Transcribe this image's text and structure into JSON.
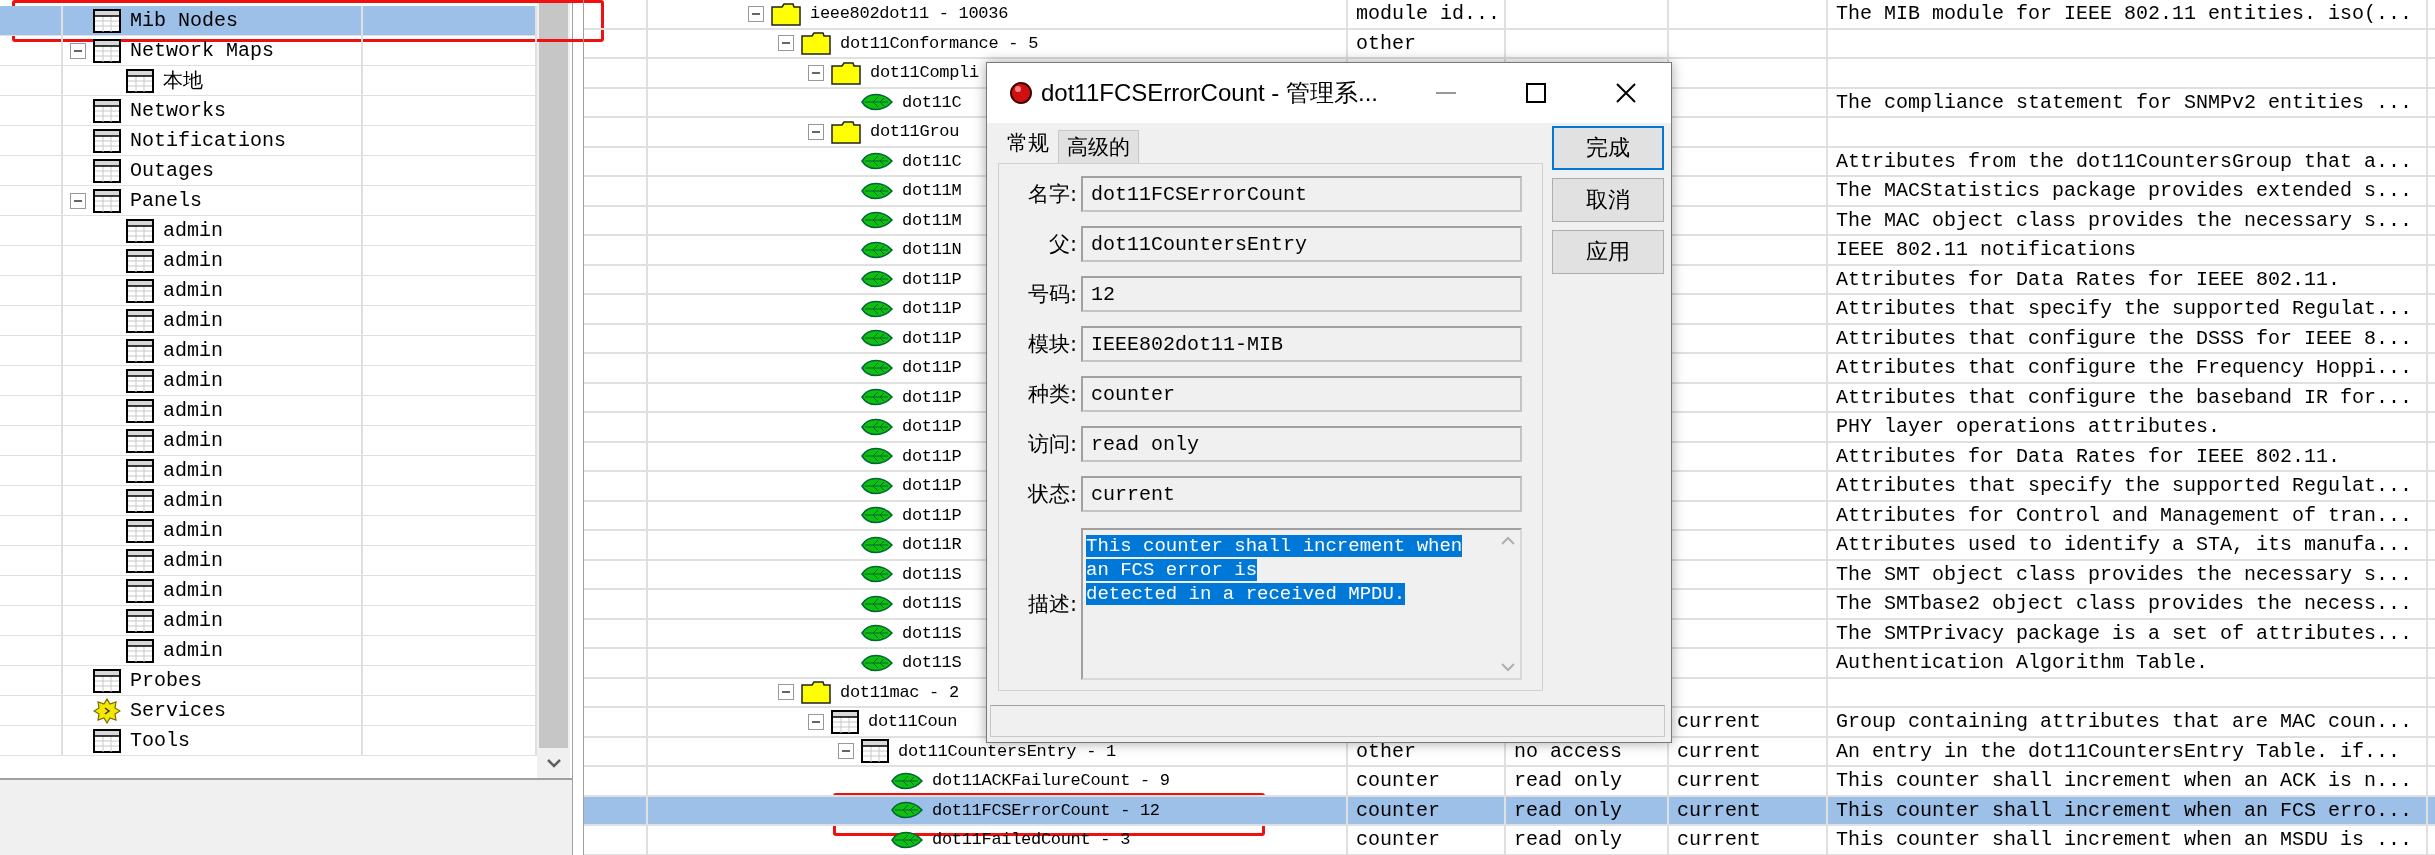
{
  "left_tree": [
    {
      "label": "Mib Nodes",
      "kind": "table",
      "selected": true,
      "highlighted": true
    },
    {
      "label": "Network Maps",
      "kind": "table",
      "selected": false,
      "expanded": true,
      "children": [
        {
          "label": "本地",
          "kind": "table",
          "selected": false
        }
      ]
    },
    {
      "label": "Networks",
      "kind": "table",
      "selected": false
    },
    {
      "label": "Notifications",
      "kind": "table",
      "selected": false
    },
    {
      "label": "Outages",
      "kind": "table",
      "selected": false
    },
    {
      "label": "Panels",
      "kind": "table",
      "selected": false,
      "expanded": true,
      "children": [
        {
          "label": "admin",
          "kind": "table",
          "selected": false
        },
        {
          "label": "admin",
          "kind": "table",
          "selected": false
        },
        {
          "label": "admin",
          "kind": "table",
          "selected": false
        },
        {
          "label": "admin",
          "kind": "table",
          "selected": false
        },
        {
          "label": "admin",
          "kind": "table",
          "selected": false
        },
        {
          "label": "admin",
          "kind": "table",
          "selected": false
        },
        {
          "label": "admin",
          "kind": "table",
          "selected": false
        },
        {
          "label": "admin",
          "kind": "table",
          "selected": false
        },
        {
          "label": "admin",
          "kind": "table",
          "selected": false
        },
        {
          "label": "admin",
          "kind": "table",
          "selected": false
        },
        {
          "label": "admin",
          "kind": "table",
          "selected": false
        },
        {
          "label": "admin",
          "kind": "table",
          "selected": false
        },
        {
          "label": "admin",
          "kind": "table",
          "selected": false
        },
        {
          "label": "admin",
          "kind": "table",
          "selected": false
        },
        {
          "label": "admin",
          "kind": "table",
          "selected": false
        }
      ]
    },
    {
      "label": "Probes",
      "kind": "table",
      "selected": false
    },
    {
      "label": "Services",
      "kind": "gear",
      "selected": false
    },
    {
      "label": "Tools",
      "kind": "table",
      "selected": false
    }
  ],
  "mib_tree": [
    {
      "name": "ieee802dot11 - 10036",
      "kind": "folder",
      "expanded": true,
      "selected": false,
      "column_2": "module id...",
      "column_5": "The MIB module for IEEE 802.11 entities. iso(...",
      "children": [
        {
          "name": "dot11Conformance - 5",
          "kind": "folder",
          "expanded": true,
          "selected": false,
          "column_2": "other",
          "children": [
            {
              "name": "dot11Compli",
              "kind": "folder",
              "expanded": true,
              "selected": false,
              "children": [
                {
                  "name": "dot11C",
                  "kind": "leaf",
                  "selected": false,
                  "column_5": "The compliance statement for SNMPv2 entities ..."
                }
              ]
            },
            {
              "name": "dot11Grou",
              "kind": "folder",
              "expanded": true,
              "selected": false,
              "children": [
                {
                  "name": "dot11C",
                  "kind": "leaf",
                  "selected": false,
                  "column_5": "Attributes from the dot11CountersGroup that a..."
                },
                {
                  "name": "dot11M",
                  "kind": "leaf",
                  "selected": false,
                  "column_5": "The MACStatistics package provides extended s..."
                },
                {
                  "name": "dot11M",
                  "kind": "leaf",
                  "selected": false,
                  "column_5": "The MAC object class provides the necessary s..."
                },
                {
                  "name": "dot11N",
                  "kind": "leaf",
                  "selected": false,
                  "column_5": "IEEE 802.11 notifications"
                },
                {
                  "name": "dot11P",
                  "kind": "leaf",
                  "selected": false,
                  "column_5": "Attributes for Data Rates for IEEE 802.11."
                },
                {
                  "name": "dot11P",
                  "kind": "leaf",
                  "selected": false,
                  "column_5": "Attributes that specify the supported Regulat..."
                },
                {
                  "name": "dot11P",
                  "kind": "leaf",
                  "selected": false,
                  "column_5": "Attributes that configure the DSSS for IEEE 8..."
                },
                {
                  "name": "dot11P",
                  "kind": "leaf",
                  "selected": false,
                  "column_5": "Attributes that configure the Frequency Hoppi..."
                },
                {
                  "name": "dot11P",
                  "kind": "leaf",
                  "selected": false,
                  "column_5": "Attributes that configure the baseband IR for..."
                },
                {
                  "name": "dot11P",
                  "kind": "leaf",
                  "selected": false,
                  "column_5": "PHY layer operations attributes."
                },
                {
                  "name": "dot11P",
                  "kind": "leaf",
                  "selected": false,
                  "column_5": "Attributes for Data Rates for IEEE 802.11."
                },
                {
                  "name": "dot11P",
                  "kind": "leaf",
                  "selected": false,
                  "column_5": "Attributes that specify the supported Regulat..."
                },
                {
                  "name": "dot11P",
                  "kind": "leaf",
                  "selected": false,
                  "column_5": "Attributes for Control and Management of tran..."
                },
                {
                  "name": "dot11R",
                  "kind": "leaf",
                  "selected": false,
                  "column_5": "Attributes used to identify a STA, its manufa..."
                },
                {
                  "name": "dot11S",
                  "kind": "leaf",
                  "selected": false,
                  "column_5": "The SMT object class provides the necessary s..."
                },
                {
                  "name": "dot11S",
                  "kind": "leaf",
                  "selected": false,
                  "column_5": "The SMTbase2 object class provides the necess..."
                },
                {
                  "name": "dot11S",
                  "kind": "leaf",
                  "selected": false,
                  "column_5": "The SMTPrivacy package is a set of attributes..."
                },
                {
                  "name": "dot11S",
                  "kind": "leaf",
                  "selected": false,
                  "column_5": "Authentication Algorithm Table."
                }
              ]
            }
          ]
        },
        {
          "name": "dot11mac - 2",
          "kind": "folder",
          "expanded": true,
          "selected": false,
          "children": [
            {
              "name": "dot11Coun",
              "kind": "table",
              "expanded": true,
              "selected": false,
              "column_4": "current",
              "column_5": "Group containing attributes that are MAC coun...",
              "children": [
                {
                  "name": "dot11CountersEntry - 1",
                  "kind": "table",
                  "expanded": true,
                  "selected": false,
                  "column_2": "other",
                  "column_3": "no access",
                  "column_4": "current",
                  "column_5": "An entry in the dot11CountersEntry Table.  if...",
                  "children": [
                    {
                      "name": "dot11ACKFailureCount - 9",
                      "kind": "leaf",
                      "selected": false,
                      "column_2": "counter",
                      "column_3": "read only",
                      "column_4": "current",
                      "column_5": "This counter shall increment when an ACK is n..."
                    },
                    {
                      "name": "dot11FCSErrorCount - 12",
                      "kind": "leaf",
                      "selected": true,
                      "highlighted": true,
                      "column_2": "counter",
                      "column_3": "read only",
                      "column_4": "current",
                      "column_5": "This counter shall increment when an FCS erro..."
                    },
                    {
                      "name": "dot11FailedCount - 3",
                      "kind": "leaf",
                      "selected": false,
                      "column_2": "counter",
                      "column_3": "read only",
                      "column_4": "current",
                      "column_5": "This counter shall increment when an MSDU is ..."
                    }
                  ]
                }
              ]
            }
          ]
        }
      ]
    }
  ],
  "dialog": {
    "title": "dot11FCSErrorCount - 管理系...",
    "tabs": [
      {
        "label": "常规",
        "selected": true
      },
      {
        "label": "高级的",
        "selected": false
      }
    ],
    "fields": [
      {
        "label": "名字:",
        "value": "dot11FCSErrorCount"
      },
      {
        "label": "父:",
        "value": "dot11CountersEntry"
      },
      {
        "label": "号码:",
        "value": "12"
      },
      {
        "label": "模块:",
        "value": "IEEE802dot11-MIB"
      },
      {
        "label": "种类:",
        "value": "counter"
      },
      {
        "label": "访问:",
        "value": "read only"
      },
      {
        "label": "状态:",
        "value": "current"
      }
    ],
    "description": {
      "label": "描述:",
      "lines": [
        "This counter shall increment when",
        "an FCS error is",
        "detected in a received MPDU."
      ],
      "selected": true
    },
    "buttons": [
      "完成",
      "取消",
      "应用"
    ]
  }
}
